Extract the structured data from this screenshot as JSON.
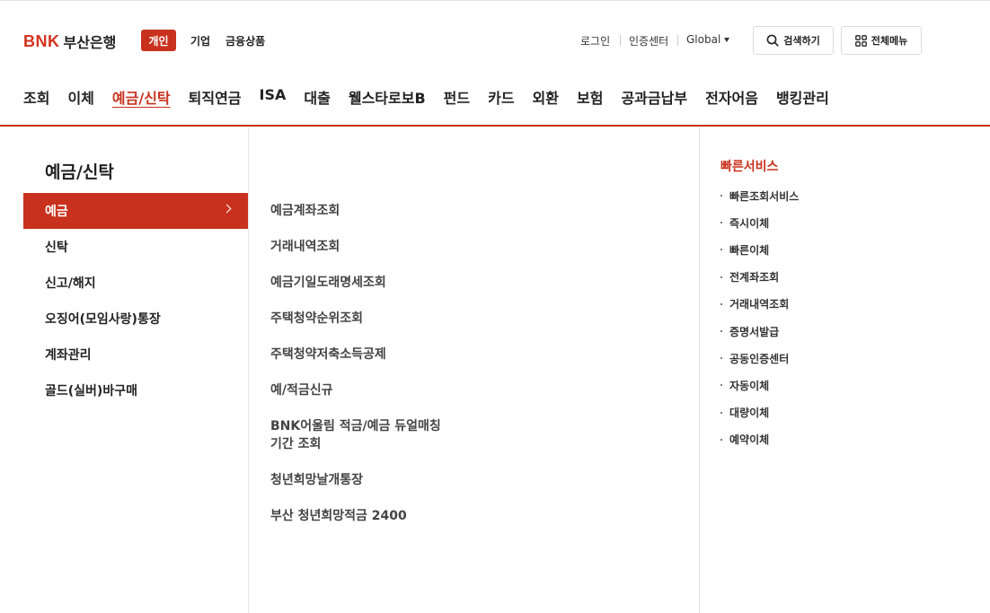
{
  "brand": {
    "bnk": "BNK",
    "name": "부산은행"
  },
  "top_tabs": {
    "personal": "개인",
    "corporate": "기업",
    "products": "금융상품"
  },
  "utility": {
    "login": "로그인",
    "cert_center": "인증센터",
    "global": "Global"
  },
  "buttons": {
    "search": "검색하기",
    "all_menu": "전체메뉴"
  },
  "gnb": [
    "조회",
    "이체",
    "예금/신탁",
    "퇴직연금",
    "ISA",
    "대출",
    "웰스타로보B",
    "펀드",
    "카드",
    "외환",
    "보험",
    "공과금납부",
    "전자어음",
    "뱅킹관리"
  ],
  "section": {
    "title": "예금/신탁",
    "items": [
      "예금",
      "신탁",
      "신고/해지",
      "오징어(모임사랑)통장",
      "계좌관리",
      "골드(실버)바구매"
    ]
  },
  "submenu": [
    "예금계좌조회",
    "거래내역조회",
    "예금기일도래명세조회",
    "주택청약순위조회",
    "주택청약저축소득공제",
    "예/적금신규",
    "BNK어울림 적금/예금 듀얼매칭\n기간 조회",
    "청년희망날개통장",
    "부산 청년희망적금 2400"
  ],
  "quick": {
    "title": "빠른서비스",
    "items": [
      "빠른조회서비스",
      "즉시이체",
      "빠른이체",
      "전계좌조회",
      "거래내역조회",
      "증명서발급",
      "공동인증센터",
      "자동이체",
      "대량이체",
      "예약이체"
    ]
  },
  "colors": {
    "accent": "#c8311d"
  }
}
